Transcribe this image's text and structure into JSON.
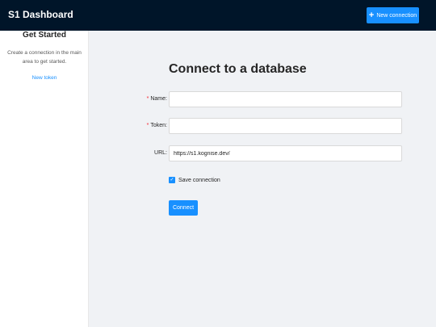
{
  "header": {
    "title": "S1 Dashboard",
    "new_connection_label": "New connection"
  },
  "sidebar": {
    "title": "Get Started",
    "description": "Create a connection in the main area to get started.",
    "link_label": "New token"
  },
  "main": {
    "title": "Connect to a database",
    "form": {
      "name_label": "Name",
      "name_value": "",
      "token_label": "Token",
      "token_value": "",
      "url_label": "URL",
      "url_value": "https://s1.kognise.dev/",
      "save_label": "Save connection",
      "save_checked": true,
      "connect_label": "Connect"
    }
  },
  "colors": {
    "header_bg": "#001529",
    "accent": "#1890ff",
    "page_bg": "#f0f2f5",
    "required": "#f5222d"
  }
}
